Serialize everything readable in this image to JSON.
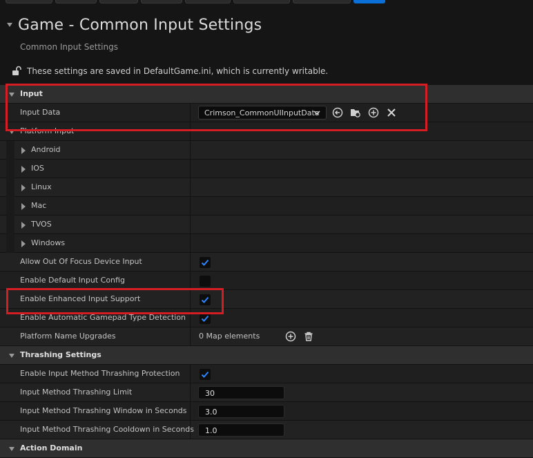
{
  "header": {
    "title": "Game - Common Input Settings",
    "subtitle": "Common Input Settings",
    "notice": "These settings are saved in DefaultGame.ini, which is currently writable."
  },
  "sections": {
    "input": "Input",
    "thrashing": "Thrashing Settings",
    "action_domain": "Action Domain"
  },
  "input": {
    "input_data_label": "Input Data",
    "input_data_value": "Crimson_CommonUIInputData"
  },
  "platform_input": {
    "label": "Platform Input",
    "platforms": [
      "Android",
      "IOS",
      "Linux",
      "Mac",
      "TVOS",
      "Windows"
    ]
  },
  "properties": {
    "allow_out_of_focus": {
      "label": "Allow Out Of Focus Device Input",
      "checked": true
    },
    "enable_default_input_config": {
      "label": "Enable Default Input Config",
      "checked": false
    },
    "enable_enhanced_input": {
      "label": "Enable Enhanced Input Support",
      "checked": true
    },
    "enable_auto_gamepad": {
      "label": "Enable Automatic Gamepad Type Detection",
      "checked": true
    },
    "platform_name_upgrades": {
      "label": "Platform Name Upgrades",
      "value": "0 Map elements"
    }
  },
  "thrashing": {
    "protection": {
      "label": "Enable Input Method Thrashing Protection",
      "checked": true
    },
    "limit": {
      "label": "Input Method Thrashing Limit",
      "value": "30"
    },
    "window": {
      "label": "Input Method Thrashing Window in Seconds",
      "value": "3.0"
    },
    "cooldown": {
      "label": "Input Method Thrashing Cooldown in Seconds",
      "value": "1.0"
    }
  },
  "colors": {
    "highlight": "#d51d24",
    "check_accent": "#2e86ff",
    "primary_button": "#0a70d8"
  }
}
